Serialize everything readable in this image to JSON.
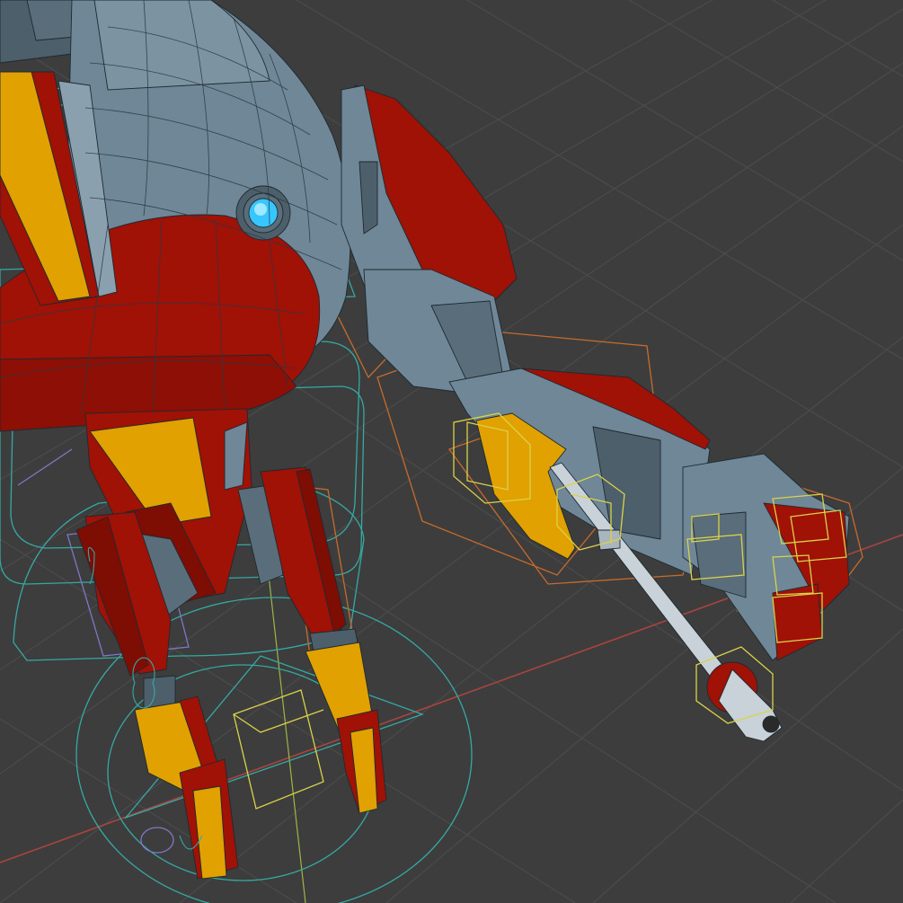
{
  "viewport": {
    "name": "3D Viewport",
    "shading": "solid-wireframe",
    "background_color": "#3d3d3d",
    "grid_color": "#4b4b4b",
    "x_axis_color": "#a8443f",
    "y_axis_color": "#7b8f32"
  },
  "model": {
    "object": "robot-mech",
    "colors": {
      "armor_red": "#a01106",
      "armor_red_dark": "#7e0d04",
      "armor_yellow": "#e1a100",
      "body_grey": "#6f8797",
      "body_grey_light": "#8aa0ae",
      "body_grey_dark": "#4d5f6b",
      "eye_glow": "#37c6ff",
      "weapon_white": "#c9d2d8",
      "wire_edge": "#1d2a31"
    }
  },
  "rig": {
    "bone_shape_colors": {
      "selected_yellow": "#d9d24a",
      "orange": "#c86a2c",
      "cyan": "#35a9a3",
      "purple": "#7f77c6",
      "green_line": "#a6c44a"
    }
  }
}
